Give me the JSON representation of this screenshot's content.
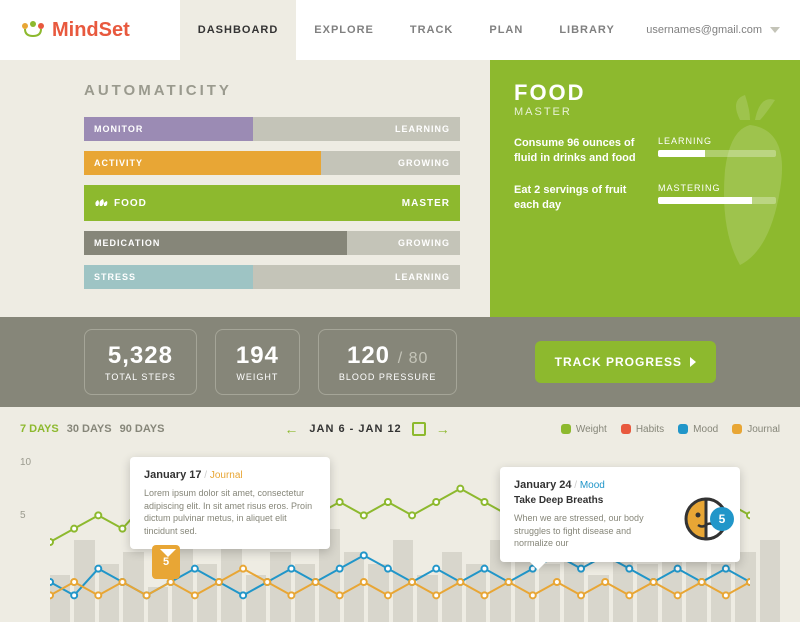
{
  "brand": "MindSet",
  "nav": {
    "items": [
      "DASHBOARD",
      "EXPLORE",
      "TRACK",
      "PLAN",
      "LIBRARY"
    ],
    "active": 0
  },
  "user": {
    "email": "usernames@gmail.com"
  },
  "automaticity": {
    "title": "AUTOMATICITY",
    "rows": [
      {
        "label": "MONITOR",
        "status": "LEARNING",
        "pct": 45,
        "color": "#9b8bb4"
      },
      {
        "label": "ACTIVITY",
        "status": "GROWING",
        "pct": 63,
        "color": "#e8a635"
      },
      {
        "label": "FOOD",
        "status": "MASTER",
        "pct": 100,
        "color": "#8db92e",
        "big": true
      },
      {
        "label": "MEDICATION",
        "status": "GROWING",
        "pct": 70,
        "color": "#868679"
      },
      {
        "label": "STRESS",
        "status": "LEARNING",
        "pct": 45,
        "color": "#9ec4c4"
      }
    ]
  },
  "food_panel": {
    "title": "FOOD",
    "subtitle": "MASTER",
    "goals": [
      {
        "text": "Consume 96 ounces of fluid in drinks and food",
        "label": "LEARNING",
        "pct": 40
      },
      {
        "text": "Eat 2 servings of fruit each day",
        "label": "MASTERING",
        "pct": 80
      }
    ]
  },
  "stats": {
    "steps": {
      "value": "5,328",
      "label": "TOTAL STEPS"
    },
    "weight": {
      "value": "194",
      "label": "WEIGHT"
    },
    "bp": {
      "value": "120",
      "sub": "/ 80",
      "label": "BLOOD PRESSURE"
    },
    "track_btn": "TRACK PROGRESS"
  },
  "chart": {
    "ranges": [
      "7 DAYS",
      "30 DAYS",
      "90 DAYS"
    ],
    "active_range": 0,
    "date_range": "JAN 6 - JAN 12",
    "legend": [
      {
        "name": "Weight",
        "color": "#8db92e"
      },
      {
        "name": "Habits",
        "color": "#e8593e"
      },
      {
        "name": "Mood",
        "color": "#2196c9"
      },
      {
        "name": "Journal",
        "color": "#e8a635"
      }
    ],
    "y_ticks": [
      "10",
      "5"
    ],
    "tooltips": {
      "journal": {
        "date": "January 17",
        "cat": "Journal",
        "body": "Lorem ipsum dolor sit amet, consectetur adipiscing elit. In sit amet risus eros. Proin dictum pulvinar metus, in aliquet elit tincidunt sed.",
        "badge": "5"
      },
      "mood": {
        "date": "January 24",
        "cat": "Mood",
        "title": "Take Deep Breaths",
        "body": "When we are stressed, our body struggles to fight disease and normalize our",
        "badge": "5"
      }
    }
  },
  "chart_data": {
    "type": "line",
    "x": [
      1,
      2,
      3,
      4,
      5,
      6,
      7,
      8,
      9,
      10,
      11,
      12,
      13,
      14,
      15,
      16,
      17,
      18,
      19,
      20,
      21,
      22,
      23,
      24,
      25,
      26,
      27,
      28,
      29,
      30
    ],
    "series": [
      {
        "name": "Weight",
        "color": "#8db92e",
        "values": [
          6,
          7,
          8,
          7,
          9,
          8,
          9,
          8,
          9,
          10,
          9,
          8,
          9,
          8,
          9,
          8,
          9,
          10,
          9,
          8,
          9,
          8,
          9,
          8,
          9,
          8,
          9,
          8,
          9,
          8
        ]
      },
      {
        "name": "Mood",
        "color": "#2196c9",
        "values": [
          3,
          2,
          4,
          3,
          2,
          3,
          4,
          3,
          2,
          3,
          4,
          3,
          4,
          5,
          4,
          3,
          4,
          3,
          4,
          3,
          4,
          5,
          4,
          5,
          4,
          3,
          4,
          3,
          4,
          3
        ]
      },
      {
        "name": "Journal",
        "color": "#e8a635",
        "values": [
          2,
          3,
          2,
          3,
          2,
          3,
          2,
          3,
          4,
          3,
          2,
          3,
          2,
          3,
          2,
          3,
          2,
          3,
          2,
          3,
          2,
          3,
          2,
          3,
          2,
          3,
          2,
          3,
          2,
          3
        ]
      }
    ],
    "bars": [
      4,
      7,
      5,
      6,
      3,
      8,
      5,
      7,
      4,
      6,
      5,
      8,
      6,
      5,
      7,
      4,
      6,
      5,
      7,
      8,
      5,
      6,
      4,
      7,
      5,
      6,
      8,
      5,
      6,
      7
    ],
    "ylim": [
      0,
      12
    ]
  }
}
